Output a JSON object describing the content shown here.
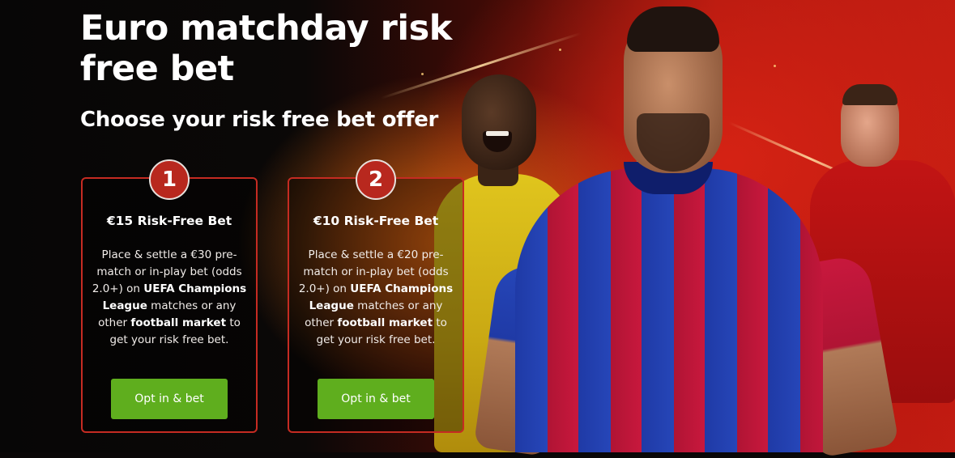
{
  "promo": {
    "headline": "Euro matchday risk free bet",
    "subheadline": "Choose your risk free bet offer"
  },
  "offers": [
    {
      "step": "1",
      "title": "€15 Risk-Free Bet",
      "desc": {
        "part1": "Place & settle a €30 pre-match or in-play bet (odds 2.0+) on ",
        "bold1": "UEFA Champions League",
        "part2": " matches or any other ",
        "bold2": "football market",
        "part3": " to get your risk free bet."
      },
      "cta_label": "Opt in & bet"
    },
    {
      "step": "2",
      "title": "€10 Risk-Free Bet",
      "desc": {
        "part1": "Place & settle a €20 pre-match or in-play bet (odds 2.0+) on ",
        "bold1": "UEFA Champions League",
        "part2": " matches or any other ",
        "bold2": "football market",
        "part3": " to get your risk free bet."
      },
      "cta_label": "Opt in & bet"
    }
  ],
  "colors": {
    "background": "#0a0707",
    "accent_red": "#c52b22",
    "cta_green": "#5fae1e",
    "text": "#ffffff"
  },
  "icons": {
    "step_badge": "numbered-circle"
  }
}
